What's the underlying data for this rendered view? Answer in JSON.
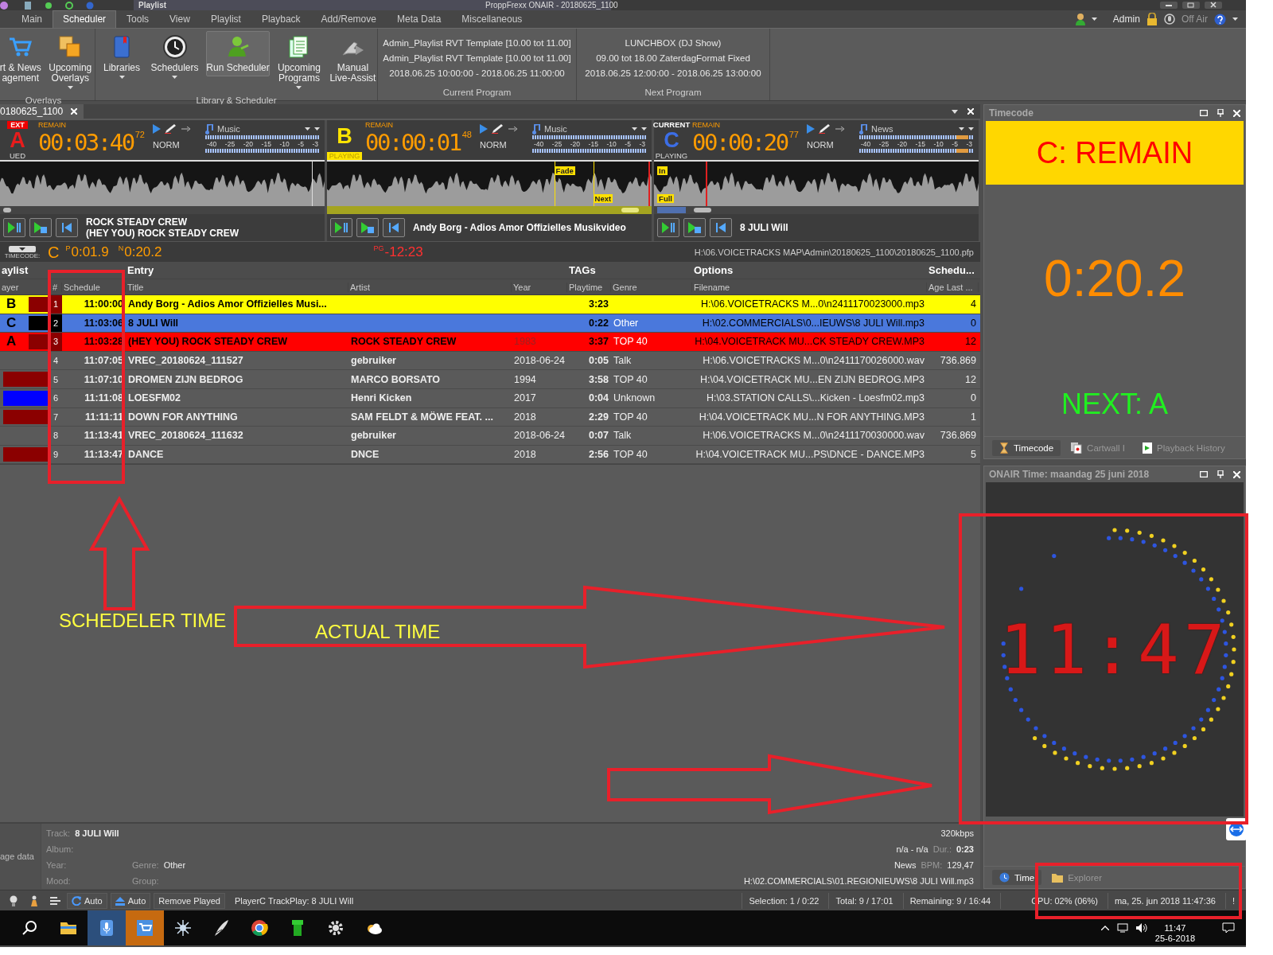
{
  "window": {
    "title": "ProppFrexx ONAIR - 20180625_1100",
    "context_tab": "Playlist"
  },
  "menu_tabs": [
    {
      "label": "Main",
      "selected": false
    },
    {
      "label": "Scheduler",
      "selected": true
    },
    {
      "label": "Tools",
      "selected": false
    },
    {
      "label": "View",
      "selected": false
    },
    {
      "label": "Playlist",
      "selected": false
    },
    {
      "label": "Playback",
      "selected": false
    },
    {
      "label": "Add/Remove",
      "selected": false
    },
    {
      "label": "Meta Data",
      "selected": false
    },
    {
      "label": "Miscellaneous",
      "selected": false
    }
  ],
  "account": {
    "user": "Admin",
    "status": "Off Air"
  },
  "ribbon_groups": [
    {
      "title": "Overlays",
      "buttons": [
        {
          "lines": [
            "rt & News",
            "agement"
          ],
          "dropdown": false,
          "selected": false
        },
        {
          "lines": [
            "Upcoming",
            "Overlays"
          ],
          "dropdown": true,
          "selected": false
        }
      ]
    },
    {
      "title": "Library & Scheduler",
      "buttons": [
        {
          "lines": [
            "Libraries"
          ],
          "dropdown": true,
          "selected": false
        },
        {
          "lines": [
            "Schedulers"
          ],
          "dropdown": true,
          "selected": false
        },
        {
          "lines": [
            "Run Scheduler"
          ],
          "dropdown": false,
          "selected": true
        },
        {
          "lines": [
            "Upcoming",
            "Programs"
          ],
          "dropdown": true,
          "selected": false
        },
        {
          "lines": [
            "Manual",
            "Live-Assist"
          ],
          "dropdown": false,
          "selected": false
        }
      ]
    }
  ],
  "programs": [
    {
      "title": "Current Program",
      "lines": [
        "Admin_Playlist RVT Template [10.00 tot 11.00]",
        "Admin_Playlist RVT Template [10.00 tot 11.00]",
        "2018.06.25 10:00:00 - 2018.06.25 11:00:00"
      ]
    },
    {
      "title": "Next Program",
      "lines": [
        "LUNCHBOX (DJ Show)",
        "09.00 tot 18.00 ZaterdagFormat Fixed",
        "2018.06.25 12:00:00 - 2018.06.25 13:00:00"
      ]
    }
  ],
  "document_tab": {
    "label": "0180625_1100"
  },
  "players": [
    {
      "kind": "next",
      "letter": "A",
      "color": "#e81c1c",
      "top_label": "EXT",
      "bottom_label": "UED",
      "remain_label": "REMAIN",
      "remain": "00:03:40",
      "remain_fraction": "72",
      "mode": "NORM",
      "category": "Music",
      "meter_ticks": [
        "-40",
        "-25",
        "-20",
        "-15",
        "-10",
        "-5",
        "-3"
      ],
      "title_lines": [
        "ROCK STEADY CREW",
        "(HEY YOU) ROCK STEADY CREW"
      ]
    },
    {
      "kind": "playing",
      "letter": "B",
      "color": "#ffe400",
      "bottom_label": "PLAYING",
      "remain_label": "REMAIN",
      "remain": "00:00:01",
      "remain_fraction": "48",
      "mode": "NORM",
      "category": "Music",
      "meter_ticks": [
        "-40",
        "-25",
        "-20",
        "-15",
        "-10",
        "-5",
        "-3"
      ],
      "markers": [
        {
          "kind": "fade",
          "text": "Fade"
        },
        {
          "kind": "next",
          "text": "Next"
        }
      ],
      "title_lines": [
        "Andy Borg - Adios Amor Offizielles Musikvideo"
      ]
    },
    {
      "kind": "current",
      "letter": "C",
      "color": "#3c6ee6",
      "top_label": "CURRENT",
      "bottom_label": "PLAYING",
      "remain_label": "REMAIN",
      "remain": "00:00:20",
      "remain_fraction": "77",
      "mode": "NORM",
      "category": "News",
      "meter_ticks": [
        "-40",
        "-25",
        "-20",
        "-15",
        "-10",
        "-5",
        "-3"
      ],
      "markers": [
        {
          "kind": "in",
          "text": "In"
        },
        {
          "kind": "full",
          "text": "Full"
        }
      ],
      "title_lines": [
        "8 JULI Will"
      ]
    }
  ],
  "timecode": {
    "label": "TIMECODE:",
    "player": "C",
    "p_label": "P",
    "p_value": "0:01.9",
    "n_label": "N",
    "n_value": "0:20.2",
    "pg_label": "PG",
    "pg_value": "-12:23",
    "path": "H:\\06.VOICETRACKS MAP\\Admin\\20180625_1100\\20180625_1100.pfp"
  },
  "playlist": {
    "groups": [
      "aylist",
      "Entry",
      "TAGs",
      "Options",
      "Schedu..."
    ],
    "columns": [
      "ayer",
      "#",
      "Schedule",
      "Title",
      "Artist",
      "Year",
      "Playtime",
      "Genre",
      "Filename",
      "Age Last ..."
    ],
    "rows": [
      {
        "kind": "playing",
        "player": "B",
        "color": "#8b0000",
        "number": "1",
        "schedule": "11:00:00",
        "title": "Andy Borg - Adios Amor Offizielles Musi...",
        "playtime": "3:23",
        "filename": "H:\\06.VOICETRACKS M...0\\n2411170023000.mp3",
        "age": "4"
      },
      {
        "kind": "current",
        "player": "C",
        "color": "#000000",
        "number": "2",
        "schedule": "11:03:06",
        "title": "8 JULI Will",
        "playtime": "0:22",
        "genre": "Other",
        "filename": "H:\\02.COMMERCIALS\\0...IEUWS\\8 JULI Will.mp3",
        "age": "0"
      },
      {
        "kind": "next",
        "player": "A",
        "color": "#8b0000",
        "number": "3",
        "schedule": "11:03:28",
        "title": "(HEY YOU) ROCK STEADY CREW",
        "artist": "ROCK STEADY CREW",
        "year": "1983",
        "playtime": "3:37",
        "genre": "TOP 40",
        "filename": "H:\\04.VOICETRACK MU...CK STEADY CREW.MP3",
        "age": "12"
      },
      {
        "number": "4",
        "schedule": "11:07:05",
        "title": "VREC_20180624_111527",
        "artist": "gebruiker",
        "year": "2018-06-24",
        "playtime": "0:05",
        "genre": "Talk",
        "filename": "H:\\06.VOICETRACKS M...0\\n2411170026000.wav",
        "age": "736.869"
      },
      {
        "color": "#8b0000",
        "number": "5",
        "schedule": "11:07:10",
        "title": "DROMEN ZIJN BEDROG",
        "artist": "MARCO BORSATO",
        "year": "1994",
        "playtime": "3:58",
        "genre": "TOP 40",
        "filename": "H:\\04.VOICETRACK MU...EN ZIJN BEDROG.MP3",
        "age": "12"
      },
      {
        "color": "#0000ff",
        "number": "6",
        "schedule": "11:11:08",
        "title": "LOESFM02",
        "artist": "Henri Kicken",
        "year": "2017",
        "playtime": "0:04",
        "genre": "Unknown",
        "filename": "H:\\03.STATION CALLS\\...Kicken - Loesfm02.mp3",
        "age": "0"
      },
      {
        "color": "#8b0000",
        "number": "7",
        "schedule": "11:11:11",
        "title": "DOWN FOR ANYTHING",
        "artist": "SAM FELDT & MÖWE FEAT. ...",
        "year": "2018",
        "playtime": "2:29",
        "genre": "TOP 40",
        "filename": "H:\\04.VOICETRACK MU...N FOR ANYTHING.MP3",
        "age": "1"
      },
      {
        "number": "8",
        "schedule": "11:13:41",
        "title": "VREC_20180624_111632",
        "artist": "gebruiker",
        "year": "2018-06-24",
        "playtime": "0:07",
        "genre": "Talk",
        "filename": "H:\\06.VOICETRACKS M...0\\n2411170030000.wav",
        "age": "736.869"
      },
      {
        "color": "#8b0000",
        "number": "9",
        "schedule": "11:13:47",
        "title": "DANCE",
        "artist": "DNCE",
        "year": "2018",
        "playtime": "2:56",
        "genre": "TOP 40",
        "filename": "H:\\04.VOICETRACK MU...PS\\DNCE - DANCE.MP3",
        "age": "5"
      }
    ]
  },
  "info": {
    "side_label": "age data",
    "fields": [
      {
        "label": "Track:",
        "value": "8 JULI Will"
      },
      {
        "label": "Album:"
      },
      {
        "label": "Year:"
      },
      {
        "label": "Genre:",
        "value": "Other"
      },
      {
        "label": "Mood:"
      },
      {
        "label": "Group:"
      }
    ],
    "bitrate": "320kbps",
    "range": "n/a - n/a",
    "duration_label": "Dur.:",
    "duration": "0:23",
    "category": "News",
    "bpm_label": "BPM:",
    "bpm": "129,47",
    "path": "H:\\02.COMMERCIALS\\01.REGIONIEUWS\\8 JULI Will.mp3"
  },
  "timecode_panel": {
    "title": "Timecode",
    "banner": "C: REMAIN",
    "time": "0:20.2",
    "next": "NEXT: A",
    "tabs": [
      {
        "label": "Timecode",
        "selected": true
      },
      {
        "label": "Cartwall I",
        "selected": false
      },
      {
        "label": "Playback History",
        "selected": false
      }
    ]
  },
  "onair_panel": {
    "title": "ONAIR Time: maandag 25 juni 2018",
    "clock": "11:47",
    "tabs": [
      {
        "label": "Time",
        "selected": true
      },
      {
        "label": "Explorer",
        "selected": false
      }
    ]
  },
  "status_bar": {
    "buttons": [
      "Auto",
      "Auto",
      "Remove Played"
    ],
    "message": "PlayerC TrackPlay: 8 JULI Will",
    "selection": "Selection: 1 / 0:22",
    "total": "Total: 9 / 17:01",
    "remaining": "Remaining: 9 / 16:44",
    "cpu": "CPU: 02% (06%)",
    "datetime": "ma, 25. jun 2018 11:47:36",
    "alert": "!"
  },
  "taskbar": {
    "time": "11:47",
    "date": "25-6-2018"
  },
  "annotations": [
    {
      "text": "SCHEDELER TIME"
    },
    {
      "text": "ACTUAL TIME"
    }
  ]
}
